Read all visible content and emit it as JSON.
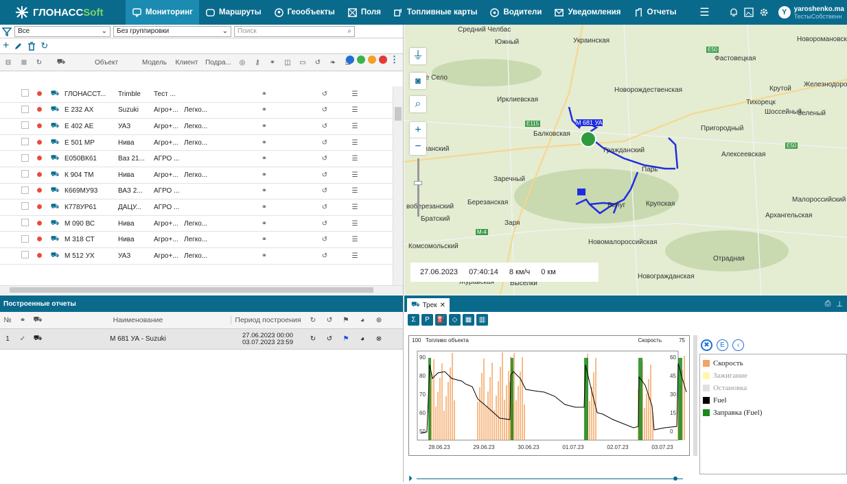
{
  "app": {
    "logo_main": "ГЛОНАСС",
    "logo_soft": "Soft",
    "user_name": "yaroshenko.ma",
    "user_sub": "ТестыСобственн",
    "avatar_letter": "Y"
  },
  "nav": [
    {
      "label": "Мониторинг",
      "icon": "monitor-icon",
      "active": true
    },
    {
      "label": "Маршруты",
      "icon": "route-icon"
    },
    {
      "label": "Геообъекты",
      "icon": "geo-icon"
    },
    {
      "label": "Поля",
      "icon": "fields-icon"
    },
    {
      "label": "Топливные карты",
      "icon": "fuel-card-icon"
    },
    {
      "label": "Водители",
      "icon": "driver-icon"
    },
    {
      "label": "Уведомления",
      "icon": "notify-icon"
    },
    {
      "label": "Отчеты",
      "icon": "reports-icon"
    }
  ],
  "monitor": {
    "filter_value": "Все",
    "group_value": "Без группировки",
    "search_placeholder": "Поиск",
    "columns": [
      "Объект",
      "Модель",
      "Клиент",
      "Подра..."
    ],
    "rows": [
      {
        "name": "ГЛОНАССТ...",
        "model": "Trimble",
        "client": "Тест ...",
        "sub": ""
      },
      {
        "name": "Е 232 АХ",
        "model": "Suzuki",
        "client": "Агро+...",
        "sub": "Легко..."
      },
      {
        "name": "Е 402 АЕ",
        "model": "УАЗ",
        "client": "Агро+...",
        "sub": "Легко..."
      },
      {
        "name": "Е 501 МР",
        "model": "Нива",
        "client": "Агро+...",
        "sub": "Легко..."
      },
      {
        "name": "Е050ВК61",
        "model": "Ваз 21...",
        "client": "АГРО ...",
        "sub": ""
      },
      {
        "name": "К 904 ТМ",
        "model": "Нива",
        "client": "Агро+...",
        "sub": "Легко..."
      },
      {
        "name": "К669МУ93",
        "model": "ВАЗ 2...",
        "client": "АГРО ...",
        "sub": ""
      },
      {
        "name": "К778УР61",
        "model": "ДАЦУ...",
        "client": "АГРО ...",
        "sub": ""
      },
      {
        "name": "М 090 ВС",
        "model": "Нива",
        "client": "Агро+...",
        "sub": "Легко..."
      },
      {
        "name": "М 318 СТ",
        "model": "Нива",
        "client": "Агро+...",
        "sub": "Легко..."
      },
      {
        "name": "М 512 УХ",
        "model": "УАЗ",
        "client": "Агро+...",
        "sub": "Легко..."
      }
    ]
  },
  "reports": {
    "title": "Построенные отчеты",
    "col_no": "№",
    "col_name": "Наименование",
    "col_period": "Период построения",
    "rows": [
      {
        "no": "1",
        "name": "М 681 УА - Suzuki",
        "period_from": "27.06.2023 00:00",
        "period_to": "03.07.2023 23:59"
      }
    ]
  },
  "map": {
    "labels": [
      "Средний Челбас",
      "Южный",
      "Украинская",
      "Новоромановский",
      "Фастовецкая",
      "вое Село",
      "Ирклиевская",
      "Новорождественская",
      "Крутой",
      "Железнодорожной станции Дв...",
      "Тихорецк",
      "Зеленый",
      "Шоссейный",
      "Пригородный",
      "Балковская",
      "Алексеевская",
      "ланский",
      "Гражданский",
      "Парь",
      "Заречный",
      "Березанская",
      "Крупская",
      "Малороссийский",
      "воберезанский",
      "Братский",
      "Заря",
      "Белуг",
      "Архангельская",
      "Комсомольский",
      "Новомалороссийская",
      "Отрадная",
      "Журавская",
      "Выселки",
      "Новогражданская",
      "М 681 УА"
    ],
    "road_labels": [
      "E50",
      "E115",
      "E50",
      "M-4"
    ],
    "info": {
      "date": "27.06.2023",
      "time": "07:40:14",
      "speed": "8 км/ч",
      "dist": "0 км"
    }
  },
  "track": {
    "tab": "Трек",
    "fuel_label": "Топливо объекта",
    "fuel_top": "100",
    "speed_label": "Скорость",
    "speed_top": "75"
  },
  "chart_data": {
    "type": "line",
    "title": "",
    "x": [
      "28.06.23",
      "29.06.23",
      "30.06.23",
      "01.07.23",
      "02.07.23",
      "03.07.23"
    ],
    "left_ticks": [
      "90",
      "80",
      "70",
      "60",
      "50"
    ],
    "right_ticks": [
      "60",
      "45",
      "30",
      "15",
      "0"
    ],
    "series": [
      {
        "name": "Скорость",
        "color": "#f4a460"
      },
      {
        "name": "Зажигание",
        "color": "#fff7a8"
      },
      {
        "name": "Остановка",
        "color": "#e0e0e0"
      },
      {
        "name": "Fuel",
        "color": "#000000"
      },
      {
        "name": "Заправка (Fuel)",
        "color": "#1a8a1a"
      }
    ],
    "ylim_left": [
      45,
      95
    ],
    "ylim_right": [
      0,
      75
    ]
  }
}
